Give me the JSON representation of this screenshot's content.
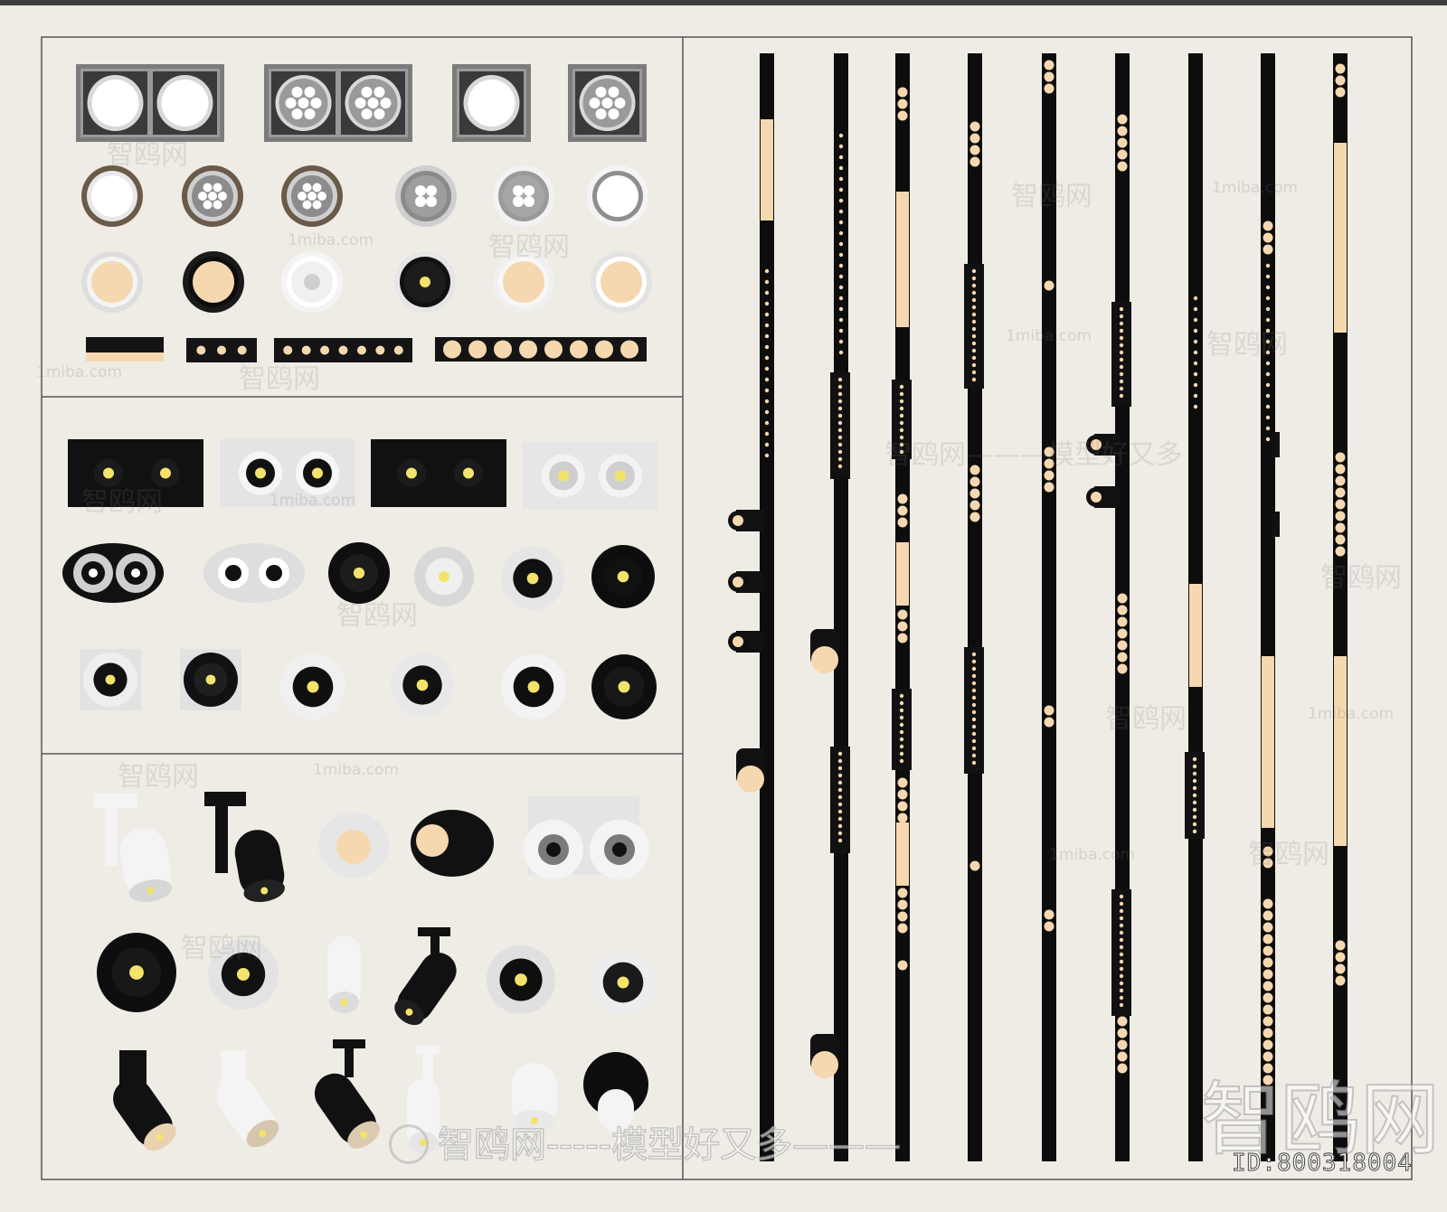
{
  "watermarks": {
    "brand_cn": "智鸥网",
    "site": "1miba.com",
    "dashes": "——————",
    "slogan": "智鸥网———模型好又多",
    "slogan_long": "智鸥网-----模型好又多———",
    "big": "智鸥网"
  },
  "id_label": "ID:800318004",
  "colors": {
    "background": "#efece5",
    "frame": "#555555",
    "dark": "#111111",
    "black": "#0d0d0d",
    "warm_light": "#f6d8b0",
    "white": "#f7f7f7",
    "grey": "#8d8d8d",
    "bronze": "#6b5a48",
    "yellow": "#f3e36a"
  },
  "items": {
    "grille_lights": [
      "double-round-grille",
      "double-multi-led-grille",
      "single-round-grille",
      "single-multi-led-grille"
    ],
    "round_downlights": 12,
    "linear_lights": 4,
    "spot_panels": 4,
    "round_spots": 12,
    "track_spots": 17,
    "magnetic_tracks": 9
  }
}
